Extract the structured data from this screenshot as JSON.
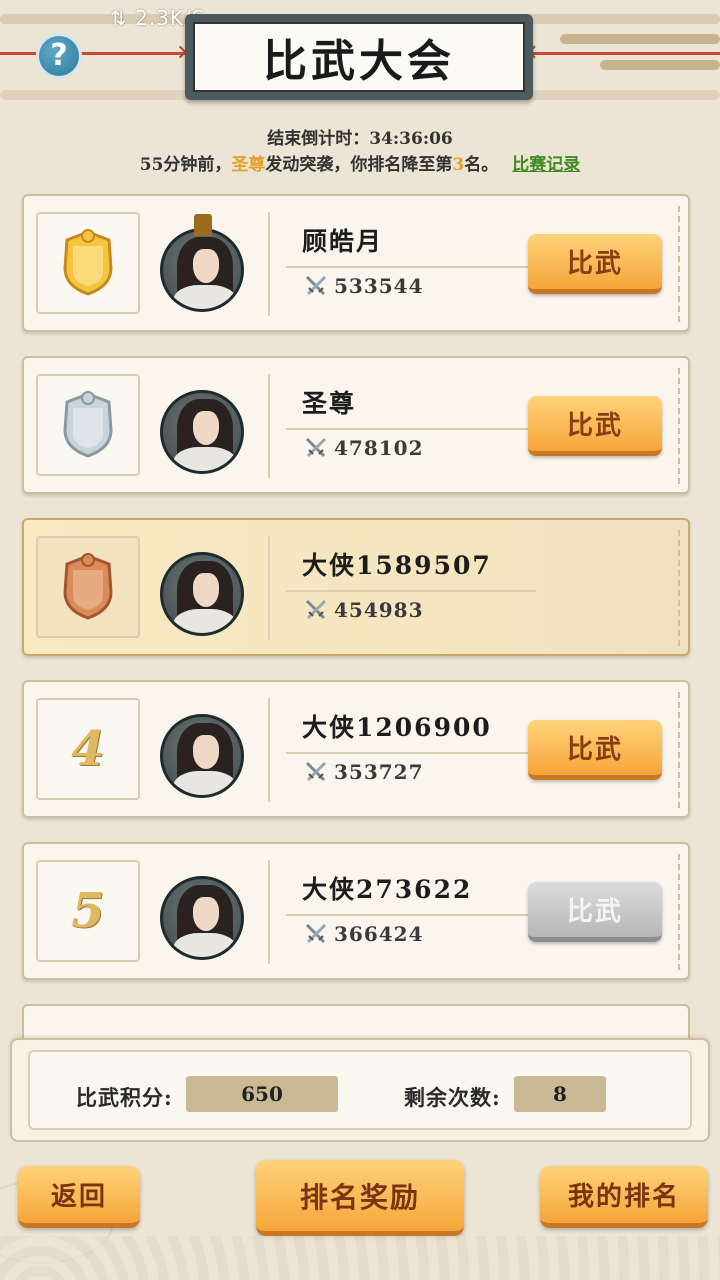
{
  "status_bar": {
    "net_speed": "2.3K/S"
  },
  "header": {
    "title": "比武大会",
    "countdown": "结束倒计时：34:36:06",
    "notice": {
      "prefix": "55分钟前，",
      "attacker": "圣尊",
      "middle": "发动突袭，你排名降至第",
      "rank": "3",
      "suffix": "名。",
      "record_link": "比赛记录"
    }
  },
  "colors": {
    "accent_orange": "#f6a53a",
    "highlight_yellow": "#e5a02a",
    "link_green": "#3e8b1f",
    "disabled_gray": "#b7b7b7"
  },
  "rankings": [
    {
      "rank": "1",
      "badge": "gold-medal-icon",
      "name": "顾皓月",
      "power": "533544",
      "button": "比武",
      "button_enabled": true,
      "is_me": false
    },
    {
      "rank": "2",
      "badge": "silver-medal-icon",
      "name": "圣尊",
      "power": "478102",
      "button": "比武",
      "button_enabled": true,
      "is_me": false
    },
    {
      "rank": "3",
      "badge": "bronze-medal-icon",
      "name": "大侠1589507",
      "power": "454983",
      "button": "",
      "button_enabled": false,
      "is_me": true
    },
    {
      "rank": "4",
      "badge": "",
      "name": "大侠1206900",
      "power": "353727",
      "button": "比武",
      "button_enabled": true,
      "is_me": false
    },
    {
      "rank": "5",
      "badge": "",
      "name": "大侠273622",
      "power": "366424",
      "button": "比武",
      "button_enabled": false,
      "is_me": false
    }
  ],
  "stats": {
    "points_label": "比武积分:",
    "points_value": "650",
    "remaining_label": "剩余次数:",
    "remaining_value": "8"
  },
  "footer": {
    "back": "返回",
    "rank_reward": "排名奖励",
    "my_rank": "我的排名"
  }
}
